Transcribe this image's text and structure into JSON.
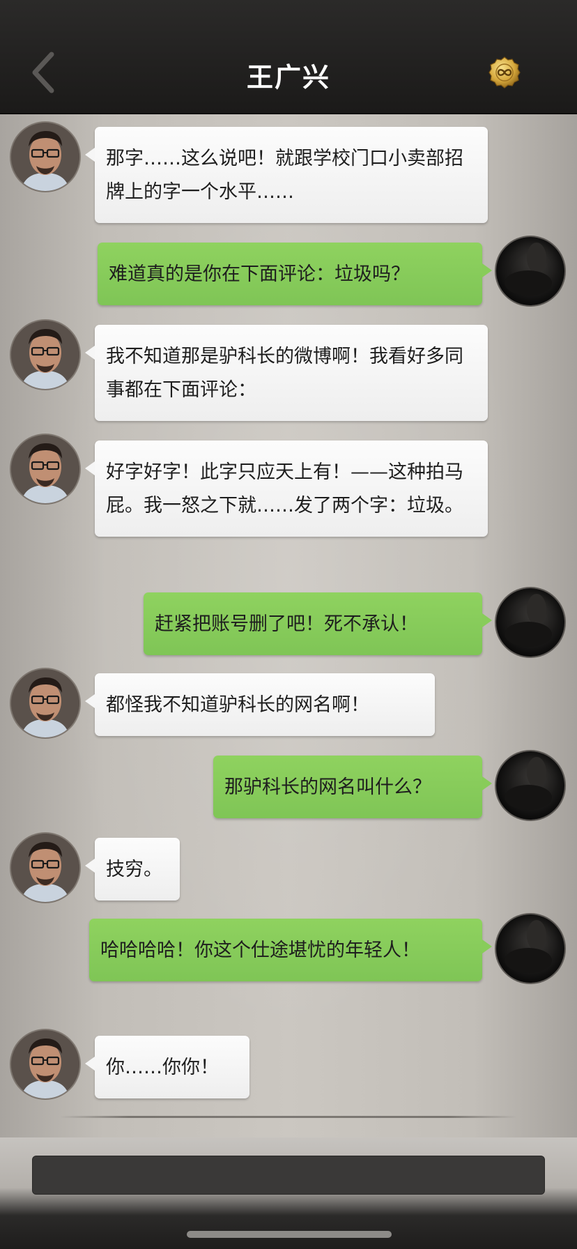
{
  "header": {
    "title": "王广兴",
    "back_icon": "chevron-left-icon",
    "coin_icon": "gold-coin-infinity-icon"
  },
  "colors": {
    "header_bg": "#1b1a19",
    "bubble_self": "#85cb58",
    "bubble_other": "#f6f6f6",
    "chat_bg": "#c4c0ba"
  },
  "messages": [
    {
      "sender": "other",
      "text": "那字……这么说吧！就跟学校门口小卖部招牌上的字一个水平……"
    },
    {
      "sender": "self",
      "text": "难道真的是你在下面评论：垃圾吗？"
    },
    {
      "sender": "other",
      "text": "我不知道那是驴科长的微博啊！我看好多同事都在下面评论："
    },
    {
      "sender": "other",
      "text": "好字好字！此字只应天上有！——这种拍马屁。我一怒之下就……发了两个字：垃圾。"
    },
    {
      "sender": "self",
      "text": "赶紧把账号删了吧！死不承认！"
    },
    {
      "sender": "other",
      "text": "都怪我不知道驴科长的网名啊！"
    },
    {
      "sender": "self",
      "text": "那驴科长的网名叫什么？"
    },
    {
      "sender": "other",
      "text": "技穷。"
    },
    {
      "sender": "self",
      "text": "哈哈哈哈！你这个仕途堪忧的年轻人！"
    },
    {
      "sender": "other",
      "text": "你……你你！"
    }
  ],
  "input": {
    "value": "",
    "placeholder": ""
  }
}
